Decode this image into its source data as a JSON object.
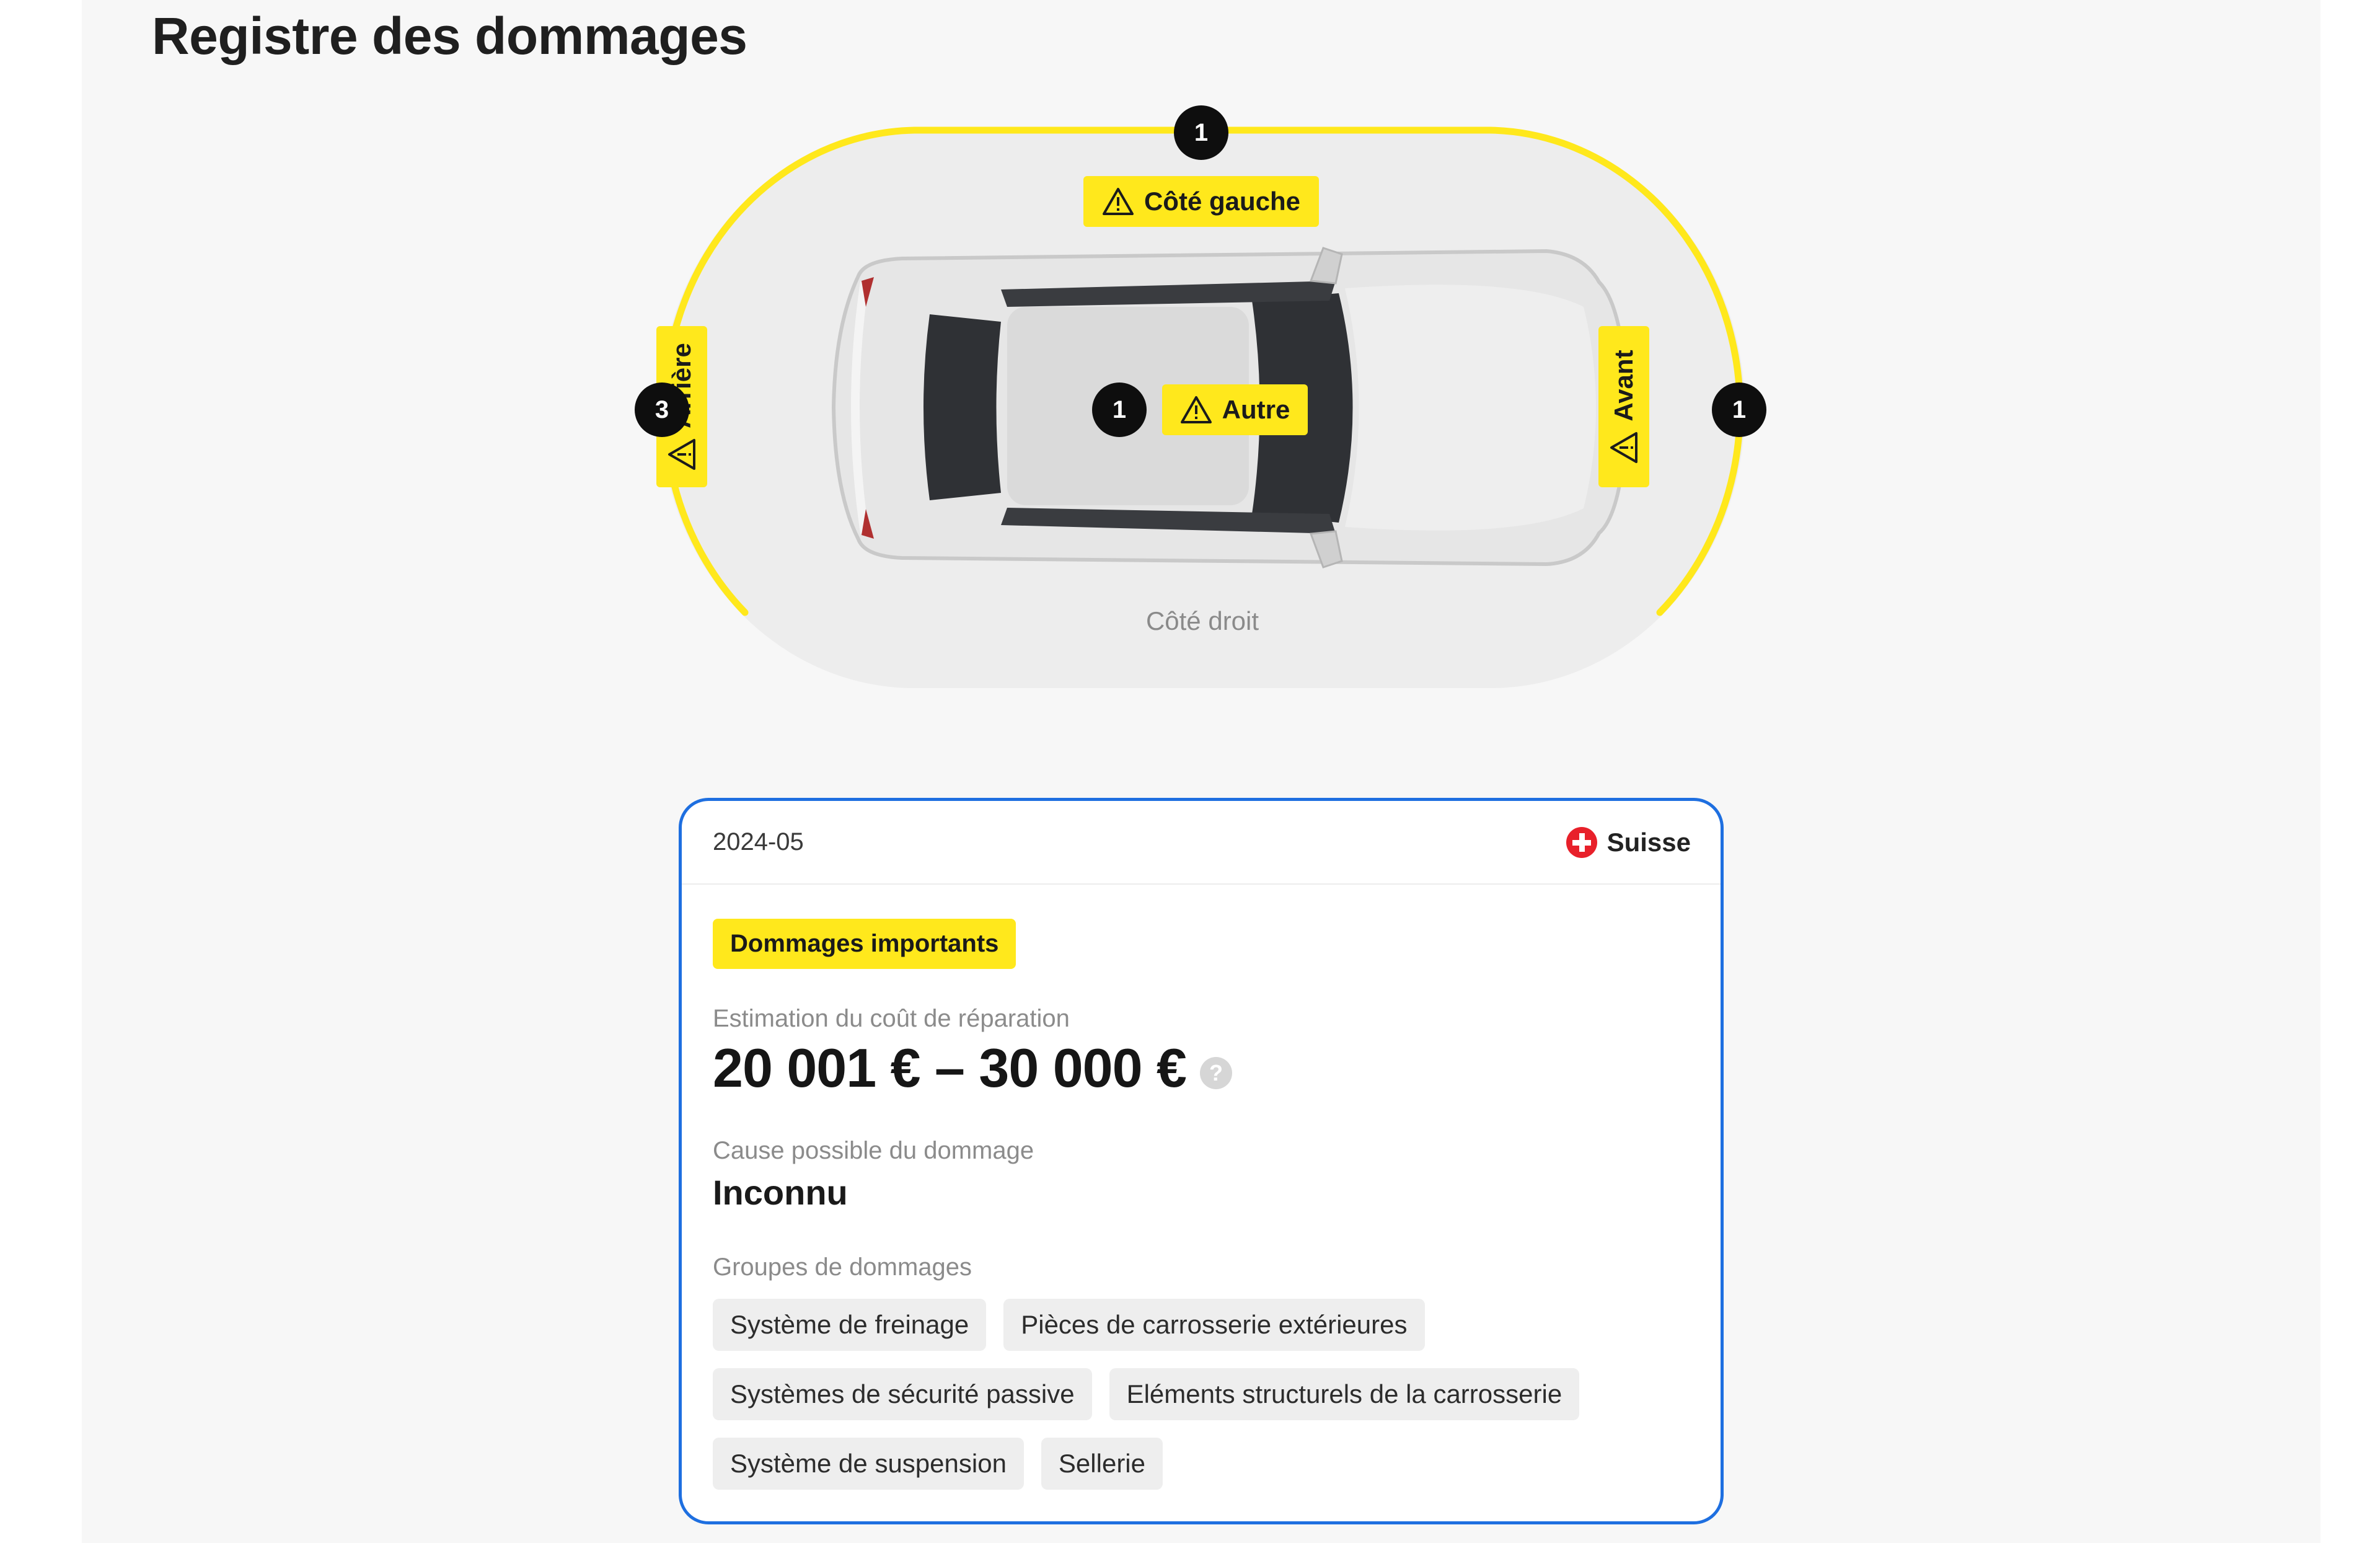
{
  "page": {
    "title": "Registre des dommages"
  },
  "diagram": {
    "zones": {
      "left_side": {
        "label": "Côté gauche",
        "count": "1"
      },
      "other": {
        "label": "Autre",
        "count": "1"
      },
      "rear": {
        "label": "Arrière",
        "count": "3"
      },
      "front": {
        "label": "Avant",
        "count": "1"
      },
      "right_side": {
        "label": "Côté droit"
      }
    },
    "highlight_color": "#ffe81c",
    "icons": [
      "warning-icon",
      "car-top-view"
    ]
  },
  "record": {
    "date": "2024-05",
    "country": "Suisse",
    "country_flag_icon": "swiss-flag-icon",
    "severity": "Dommages importants",
    "cost_label": "Estimation du coût de réparation",
    "cost_value": "20 001 € – 30 000 €",
    "help_glyph": "?",
    "cause_label": "Cause possible du dommage",
    "cause_value": "Inconnu",
    "groups_label": "Groupes de dommages",
    "groups": [
      "Système de freinage",
      "Pièces de carrosserie extérieures",
      "Systèmes de sécurité passive",
      "Eléments structurels de la carrosserie",
      "Système de suspension",
      "Sellerie"
    ],
    "accent_color": "#1e6fe0"
  }
}
